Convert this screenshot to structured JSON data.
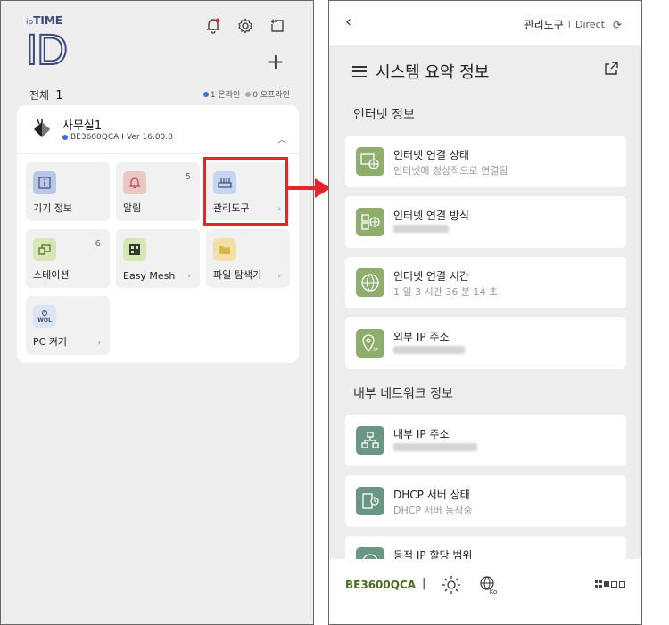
{
  "left": {
    "logo_small_ip": "ip",
    "logo_small": "TIME",
    "logo_big": "ID",
    "plus": "+",
    "total_label": "전체",
    "total_count": "1",
    "online_count": "1",
    "online_label": "온라인",
    "offline_count": "0",
    "offline_label": "오프라인",
    "device": {
      "name": "사무실1",
      "model": "BE3600QCA",
      "separator": "I",
      "version": "Ver 16.00.0"
    },
    "tiles": [
      {
        "label": "기기 정보",
        "count": "",
        "arrow": ""
      },
      {
        "label": "알림",
        "count": "5",
        "arrow": ""
      },
      {
        "label": "관리도구",
        "count": "",
        "arrow": "›"
      },
      {
        "label": "스테이션",
        "count": "6",
        "arrow": ""
      },
      {
        "label": "Easy Mesh",
        "count": "",
        "arrow": "›"
      },
      {
        "label": "파일 탐색기",
        "count": "",
        "arrow": "›"
      },
      {
        "label": "PC 켜기",
        "count": "",
        "arrow": "›"
      }
    ]
  },
  "right": {
    "header": {
      "back": "‹",
      "tool_label": "관리도구",
      "sep": "I",
      "mode": "Direct",
      "refresh": "⟳"
    },
    "title": "시스템 요약 정보",
    "section_internet": "인터넷 정보",
    "section_internal": "내부 네트워크 정보",
    "items": [
      {
        "title": "인터넷 연결 상태",
        "value": "인터넷에 정상적으로 연결됨"
      },
      {
        "title": "인터넷 연결 방식",
        "value": ""
      },
      {
        "title": "인터넷 연결 시간",
        "value": "1 일 3 시간 36 분 14 초"
      },
      {
        "title": "외부 IP 주소",
        "value": ""
      },
      {
        "title": "내부 IP 주소",
        "value": ""
      },
      {
        "title": "DHCP 서버 상태",
        "value": "DHCP 서버 동작중"
      },
      {
        "title": "동적 IP 할당 범위",
        "value": ""
      }
    ],
    "footer": {
      "model": "BE3600QCA",
      "bar": "|",
      "lang": "Ko"
    }
  },
  "colors": {
    "accent_red": "#e3262b",
    "brand_navy": "#3a4b7a",
    "icon_green": "#8fae6e",
    "icon_teal": "#6a9684",
    "online_blue": "#3a6fd8"
  }
}
